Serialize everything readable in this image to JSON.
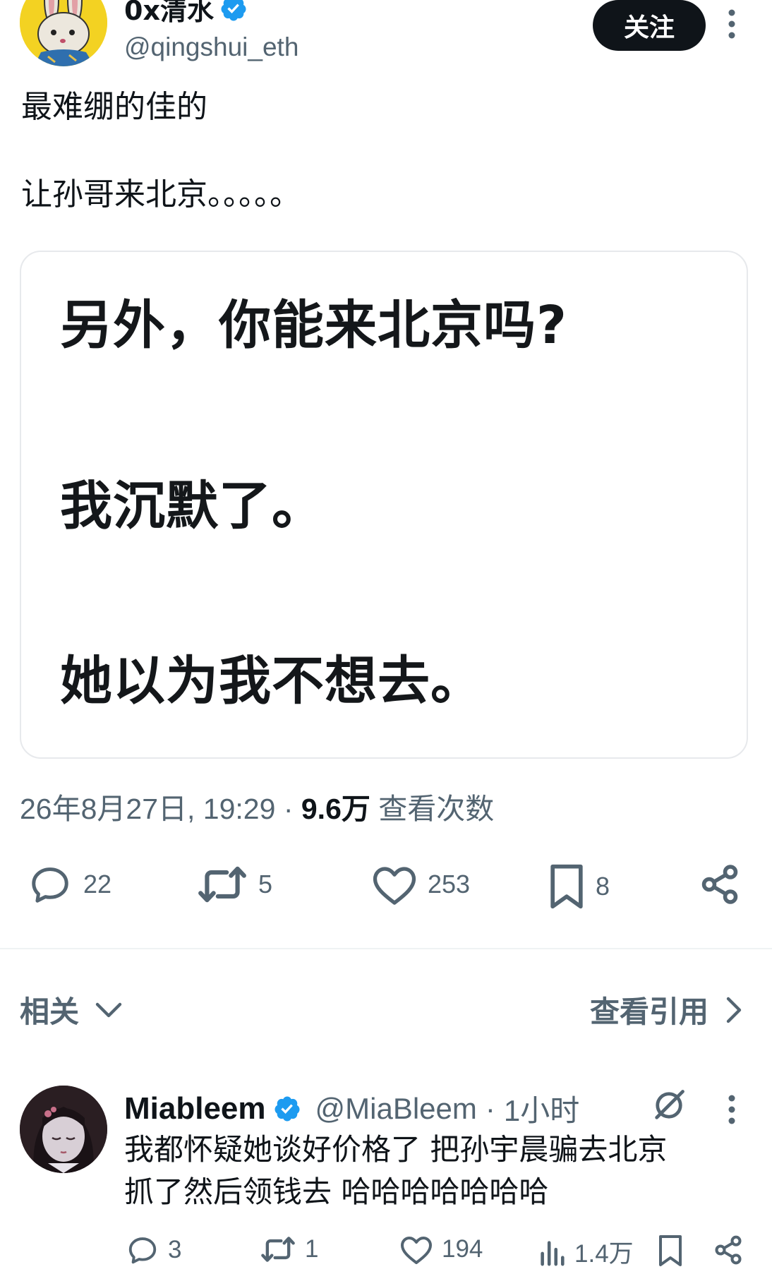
{
  "tweet": {
    "author": {
      "display_name": "0x清水",
      "handle": "@qingshui_eth",
      "verified": true,
      "avatar": "rabbit-avatar"
    },
    "follow_label": "关注",
    "text_lines": [
      "最难绷的佳的",
      "让孙哥来北京。。。。。"
    ],
    "media_lines": [
      "另外，你能来北京吗?",
      "我沉默了。",
      "她以为我不想去。"
    ],
    "timestamp": "26年8月27日, 19:29",
    "separator": "·",
    "views_count": "9.6万",
    "views_label": "查看次数",
    "actions": {
      "replies": "22",
      "retweets": "5",
      "likes": "253",
      "bookmarks": "8"
    }
  },
  "related": {
    "label": "相关",
    "quotes_link": "查看引用"
  },
  "reply": {
    "display_name": "Miableem",
    "handle": "@MiaBleem",
    "time": "1小时",
    "separator": "·",
    "verified": true,
    "text_lines": [
      "我都怀疑她谈好价格了 把孙宇晨骗去北京",
      "抓了然后领钱去 哈哈哈哈哈哈哈"
    ],
    "actions": {
      "replies": "3",
      "retweets": "1",
      "likes": "194",
      "views": "1.4万"
    }
  },
  "colors": {
    "verified_blue": "#1d9bf0",
    "text_primary": "#0f1419",
    "text_secondary": "#536471",
    "follow_button": "#0f1419"
  }
}
